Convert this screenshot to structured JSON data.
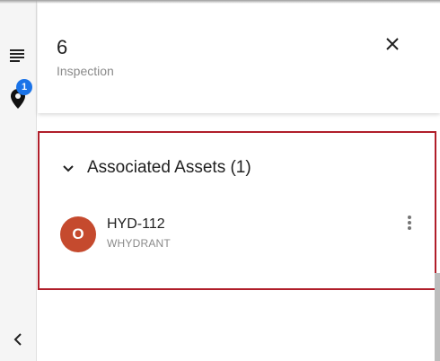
{
  "rail": {
    "location_badge_count": "1",
    "icons": [
      "list-icon",
      "location-pin-icon",
      "chevron-left-icon"
    ]
  },
  "header": {
    "title": "6",
    "subtitle": "Inspection",
    "close_icon": "close-icon"
  },
  "section": {
    "title": "Associated Assets",
    "count": "(1)",
    "toggle_icon": "chevron-down-icon",
    "accent_color": "#b01e2a",
    "assets": [
      {
        "avatar_letter": "O",
        "avatar_color": "#c54a2e",
        "name": "HYD-112",
        "type": "WHYDRANT",
        "menu_icon": "more-vert-icon"
      }
    ]
  },
  "colors": {
    "badge": "#1a73e8",
    "rail_background": "#f5f5f5"
  }
}
